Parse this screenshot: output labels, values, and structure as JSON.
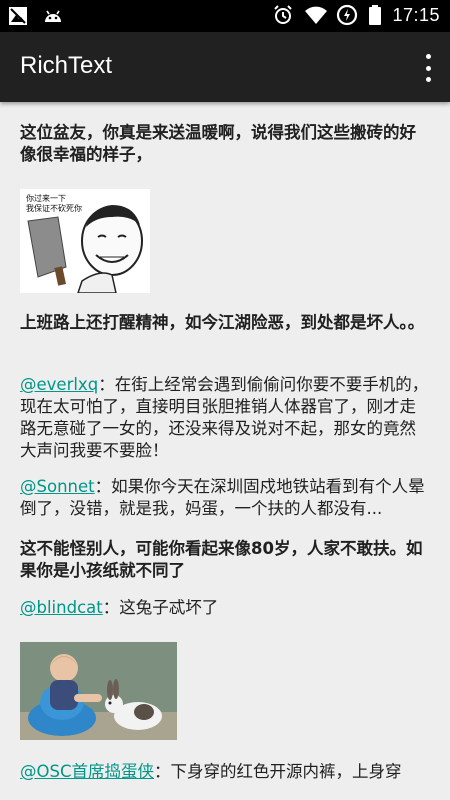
{
  "status_bar": {
    "time": "17:15",
    "left_icons": [
      "image-icon",
      "android-icon"
    ],
    "right_icons": [
      "alarm-icon",
      "wifi-icon",
      "data-saver-icon",
      "battery-icon"
    ]
  },
  "app_bar": {
    "title": "RichText",
    "menu_icon": "more-vertical-icon"
  },
  "content": {
    "post1_text": "这位盆友，你真是来送温暖啊，说得我们这些搬砖的好像很幸福的样子，",
    "meme_caption_line1": "你过来一下",
    "meme_caption_line2": "我保证不砍死你",
    "post2_text": "上班路上还打醒精神，如今江湖险恶，到处都是坏人。。",
    "comment1": {
      "mention": "@everlxq",
      "text": "：在街上经常会遇到偷偷问你要不要手机的，现在太可怕了，直接明目张胆推销人体器官了，刚才走路无意碰了一女的，还没来得及说对不起，那女的竟然大声问我要不要脸！"
    },
    "comment2": {
      "mention": "@Sonnet",
      "text": "：如果你今天在深圳固戍地铁站看到有个人晕倒了，没错，就是我，妈蛋，一个扶的人都没有..."
    },
    "post3_text": "这不能怪别人，可能你看起来像80岁，人家不敢扶。如果你是小孩纸就不同了",
    "comment3": {
      "mention": "@blindcat",
      "text": "：这兔子忒坏了"
    },
    "comment4": {
      "mention": "@OSC首席捣蛋侠",
      "text": "：下身穿的红色开源内裤，上身穿"
    }
  },
  "colors": {
    "status_bar": "#000000",
    "app_bar": "#212121",
    "background": "#eeeeee",
    "mention": "#009688"
  }
}
